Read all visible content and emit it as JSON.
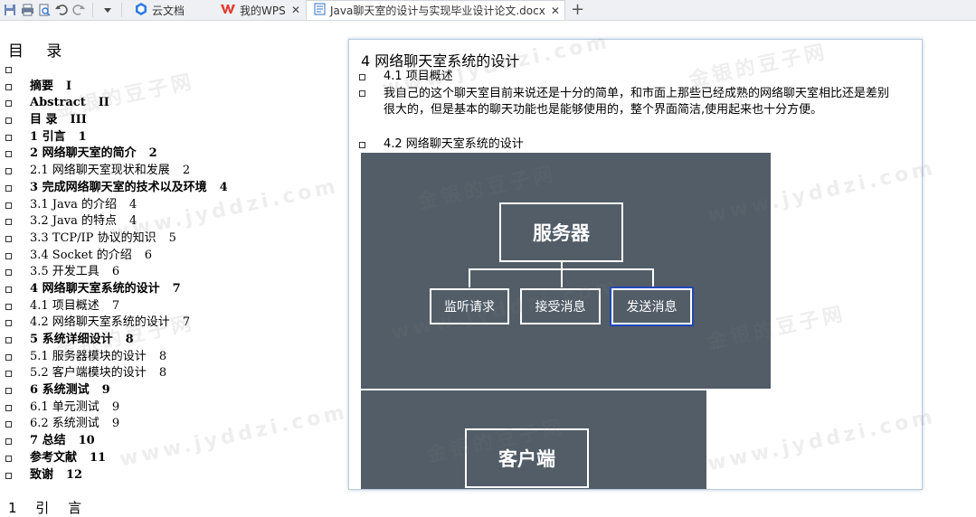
{
  "tabs": [
    {
      "label": "云文档",
      "icon": "cloud-doc-icon",
      "active": false
    },
    {
      "label": "我的WPS",
      "icon": "wps-logo-icon",
      "active": false
    },
    {
      "label": "Java聊天室的设计与实现毕业设计论文.docx",
      "icon": "word-doc-icon",
      "active": true
    }
  ],
  "toc": {
    "title": "目  录",
    "items": [
      {
        "text": "",
        "page": "",
        "bold": false
      },
      {
        "text": "摘要",
        "page": "I",
        "bold": true
      },
      {
        "text": "Abstract",
        "page": "II",
        "bold": true
      },
      {
        "text": "目 录",
        "page": "III",
        "bold": true
      },
      {
        "text": "1 引言",
        "page": "1",
        "bold": true
      },
      {
        "text": "2 网络聊天室的简介",
        "page": "2",
        "bold": true
      },
      {
        "text": "2.1 网络聊天室现状和发展",
        "page": "2",
        "bold": false
      },
      {
        "text": "3 完成网络聊天室的技术以及环境",
        "page": "4",
        "bold": true
      },
      {
        "text": "3.1 Java 的介绍",
        "page": "4",
        "bold": false
      },
      {
        "text": "3.2 Java 的特点",
        "page": "4",
        "bold": false
      },
      {
        "text": "3.3 TCP/IP 协议的知识",
        "page": "5",
        "bold": false
      },
      {
        "text": "3.4 Socket 的介绍",
        "page": "6",
        "bold": false
      },
      {
        "text": "3.5 开发工具",
        "page": "6",
        "bold": false
      },
      {
        "text": "4 网络聊天室系统的设计",
        "page": "7",
        "bold": true
      },
      {
        "text": "4.1 项目概述",
        "page": "7",
        "bold": false
      },
      {
        "text": "4.2 网络聊天室系统的设计",
        "page": "7",
        "bold": false
      },
      {
        "text": "5 系统详细设计",
        "page": "8",
        "bold": true
      },
      {
        "text": "5.1 服务器模块的设计",
        "page": "8",
        "bold": false
      },
      {
        "text": "5.2 客户端模块的设计",
        "page": "8",
        "bold": false
      },
      {
        "text": "6 系统测试",
        "page": "9",
        "bold": true
      },
      {
        "text": "6.1 单元测试",
        "page": "9",
        "bold": false
      },
      {
        "text": "6.2 系统测试",
        "page": "9",
        "bold": false
      },
      {
        "text": "7 总结",
        "page": "10",
        "bold": true
      },
      {
        "text": "参考文献",
        "page": "11",
        "bold": true
      },
      {
        "text": "致谢",
        "page": "12",
        "bold": true
      }
    ]
  },
  "bottom_heading": "1 引 言",
  "preview": {
    "heading": "4 网络聊天室系统的设计",
    "sub1": "4.1 项目概述",
    "paragraph": "我自己的这个聊天室目前来说还是十分的简单，和市面上那些已经成熟的网络聊天室相比还是差别很大的，但是基本的聊天功能也是能够使用的，整个界面简洁,使用起来也十分方便。",
    "sub2": "4.2 网络聊天室系统的设计",
    "diagram": {
      "server": "服务器",
      "children": [
        "监听请求",
        "接受消息",
        "发送消息"
      ],
      "client": "客户端"
    }
  },
  "watermark": {
    "line1": "金银的豆子网",
    "line2": "www.jyddzi.com"
  }
}
